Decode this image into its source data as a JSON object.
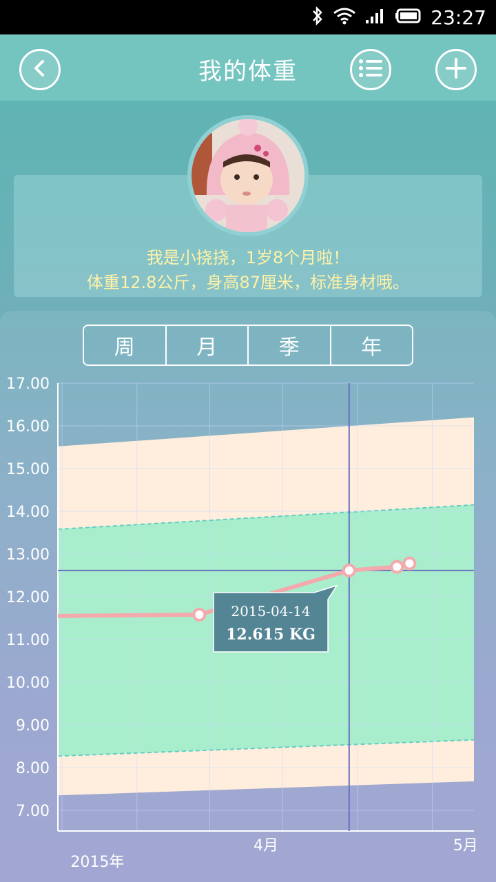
{
  "status_bar": {
    "time": "23:27"
  },
  "header": {
    "title": "我的体重"
  },
  "profile": {
    "line1": "我是小挠挠，1岁8个月啦！",
    "line2": "体重12.8公斤，身高87厘米，标准身材哦。"
  },
  "tabs": [
    {
      "label": "周"
    },
    {
      "label": "月"
    },
    {
      "label": "季"
    },
    {
      "label": "年"
    }
  ],
  "tooltip": {
    "date": "2015-04-14",
    "value": "12.615 KG"
  },
  "chart_data": {
    "type": "line",
    "ylim": [
      7,
      17
    ],
    "y_ticks": [
      "17.00",
      "16.00",
      "15.00",
      "14.00",
      "13.00",
      "12.00",
      "11.00",
      "10.00",
      "9.00",
      "8.00",
      "7.00"
    ],
    "x_labels": [
      {
        "text": "2015年",
        "pos": 0.095
      },
      {
        "text": "4月",
        "pos": 0.5
      },
      {
        "text": "5月",
        "pos": 0.98
      }
    ],
    "series": [
      {
        "values": [
          {
            "t": 0.0,
            "y": 11.55
          },
          {
            "t": 0.34,
            "y": 11.58
          },
          {
            "t": 0.7,
            "y": 12.615
          },
          {
            "t": 0.815,
            "y": 12.7
          },
          {
            "t": 0.845,
            "y": 12.78
          }
        ]
      }
    ],
    "bands": {
      "outer_upper": [
        15.52,
        16.2
      ],
      "inner_upper": [
        13.58,
        14.15
      ],
      "inner_lower": [
        8.27,
        8.65
      ],
      "outer_lower": [
        7.35,
        7.68
      ]
    },
    "crosshair": {
      "t": 0.7,
      "y": 12.615
    },
    "colors": {
      "outer_band": "#ffeedd",
      "inner_band": "#a8eecc",
      "line": "#f4a9ad",
      "crosshair": "#6a6fc0",
      "tooltip": "#548594"
    }
  }
}
